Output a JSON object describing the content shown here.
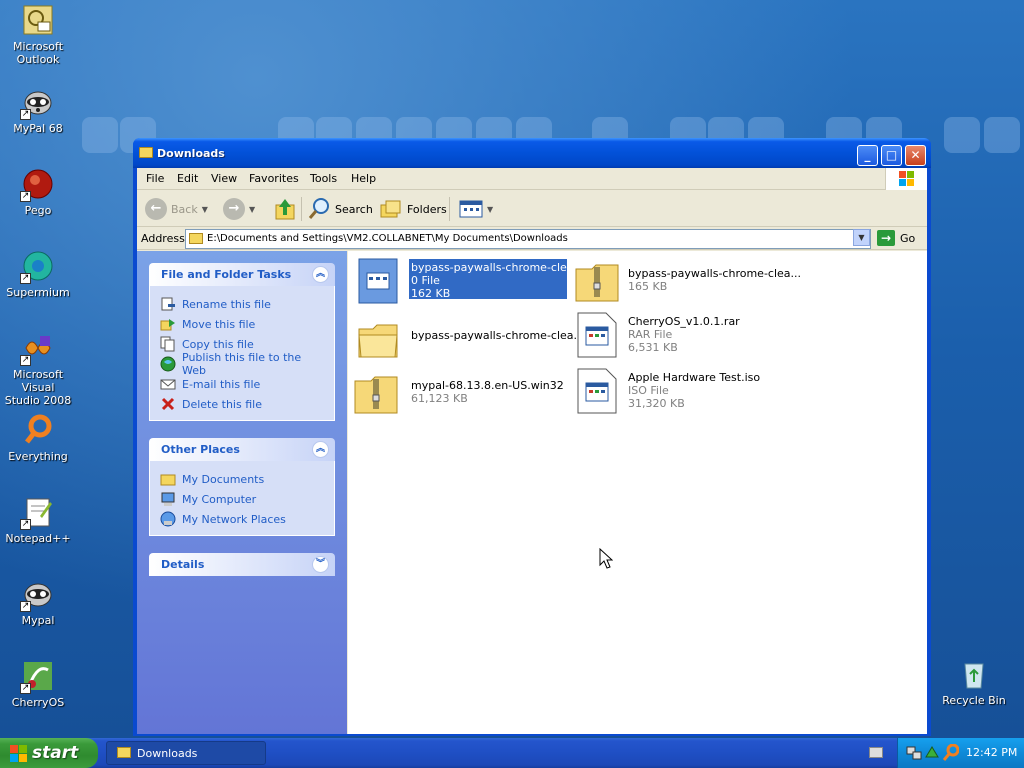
{
  "desktop": {
    "icons": [
      {
        "label": "Microsoft\nOutlook",
        "line1": "Microsoft",
        "line2": "Outlook"
      },
      {
        "line1": "MyPal 68",
        "line2": ""
      },
      {
        "line1": "Pego",
        "line2": ""
      },
      {
        "line1": "Supermium",
        "line2": ""
      },
      {
        "line1": "Microsoft Visual",
        "line2": "Studio 2008"
      },
      {
        "line1": "Everything",
        "line2": ""
      },
      {
        "line1": "Notepad++",
        "line2": ""
      },
      {
        "line1": "Mypal",
        "line2": ""
      },
      {
        "line1": "CherryOS",
        "line2": ""
      },
      {
        "line1": "Recycle Bin",
        "line2": ""
      }
    ]
  },
  "window": {
    "title": "Downloads",
    "minimize_label": "_",
    "maximize_label": "□",
    "close_label": "✕"
  },
  "menu": [
    "File",
    "Edit",
    "View",
    "Favorites",
    "Tools",
    "Help"
  ],
  "toolbar": {
    "back": "Back",
    "search": "Search",
    "folders": "Folders"
  },
  "address": {
    "label": "Address",
    "path": "E:\\Documents and Settings\\VM2.COLLABNET\\My Documents\\Downloads",
    "go": "Go"
  },
  "tasks_panel": {
    "file_folder_tasks": {
      "title": "File and Folder Tasks",
      "items": [
        "Rename this file",
        "Move this file",
        "Copy this file",
        "Publish this file to the Web",
        "E-mail this file",
        "Delete this file"
      ]
    },
    "other_places": {
      "title": "Other Places",
      "items": [
        "My Documents",
        "My Computer",
        "My Network Places"
      ]
    },
    "details": {
      "title": "Details"
    }
  },
  "files": [
    {
      "name": "bypass-paywalls-chrome-clea...",
      "type": "0 File",
      "size": "162 KB",
      "icon": "generic-file-icon",
      "selected": true
    },
    {
      "name": "bypass-paywalls-chrome-clea...",
      "type": "",
      "size": "165 KB",
      "icon": "zip-folder-icon",
      "selected": false
    },
    {
      "name": "bypass-paywalls-chrome-clea...",
      "type": "",
      "size": "",
      "icon": "folder-icon",
      "selected": false
    },
    {
      "name": "CherryOS_v1.0.1.rar",
      "type": "RAR File",
      "size": "6,531 KB",
      "icon": "rar-file-icon",
      "selected": false
    },
    {
      "name": "mypal-68.13.8.en-US.win32",
      "type": "",
      "size": "61,123 KB",
      "icon": "zip-folder-icon",
      "selected": false
    },
    {
      "name": "Apple Hardware Test.iso",
      "type": "ISO File",
      "size": "31,320 KB",
      "icon": "iso-file-icon",
      "selected": false
    }
  ],
  "taskbar": {
    "start": "start",
    "task": "Downloads",
    "clock": "12:42 PM"
  },
  "colors": {
    "desktop": "#1c5fa8",
    "titlebar": "#0251d8",
    "taskpane": "#6f8cdf",
    "selection": "#316ac5",
    "start": "#3a9a3a"
  }
}
